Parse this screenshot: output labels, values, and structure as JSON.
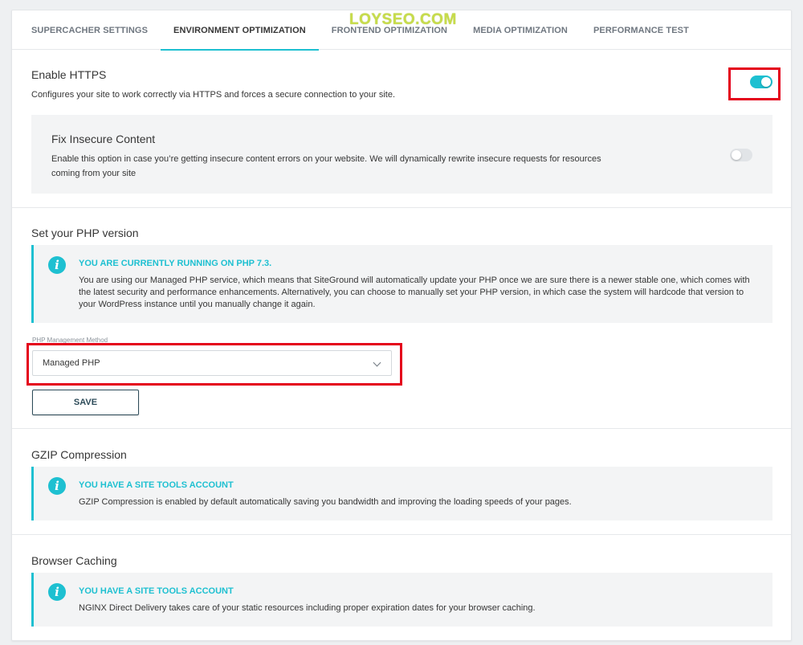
{
  "watermark": "LOYSEO.COM",
  "tabs": [
    {
      "label": "SUPERCACHER SETTINGS"
    },
    {
      "label": "ENVIRONMENT OPTIMIZATION"
    },
    {
      "label": "FRONTEND OPTIMIZATION"
    },
    {
      "label": "MEDIA OPTIMIZATION"
    },
    {
      "label": "PERFORMANCE TEST"
    }
  ],
  "active_tab": "ENVIRONMENT OPTIMIZATION",
  "https": {
    "title": "Enable HTTPS",
    "description": "Configures your site to work correctly via HTTPS and forces a secure connection to your site.",
    "enabled": true,
    "fix_insecure": {
      "title": "Fix Insecure Content",
      "description": "Enable this option in case you’re getting insecure content errors on your website. We will dynamically rewrite insecure requests for resources coming from your site",
      "enabled": false
    }
  },
  "php": {
    "title": "Set your PHP version",
    "info_title": "YOU ARE CURRENTLY RUNNING ON PHP 7.3.",
    "info_text": "You are using our Managed PHP service, which means that SiteGround will automatically update your PHP once we are sure there is a newer stable one, which comes with the latest security and performance enhancements. Alternatively, you can choose to manually set your PHP version, in which case the system will hardcode that version to your WordPress instance until you manually change it again.",
    "method_label": "PHP Management Method",
    "method_value": "Managed PHP",
    "save_label": "SAVE"
  },
  "gzip": {
    "title": "GZIP Compression",
    "info_title": "YOU HAVE A SITE TOOLS ACCOUNT",
    "info_text": "GZIP Compression is enabled by default automatically saving you bandwidth and improving the loading speeds of your pages."
  },
  "browser_caching": {
    "title": "Browser Caching",
    "info_title": "YOU HAVE A SITE TOOLS ACCOUNT",
    "info_text": "NGINX Direct Delivery takes care of your static resources including proper expiration dates for your browser caching."
  },
  "colors": {
    "accent": "#1ec0d1",
    "highlight": "#e4001b",
    "panel": "#f3f4f5"
  }
}
